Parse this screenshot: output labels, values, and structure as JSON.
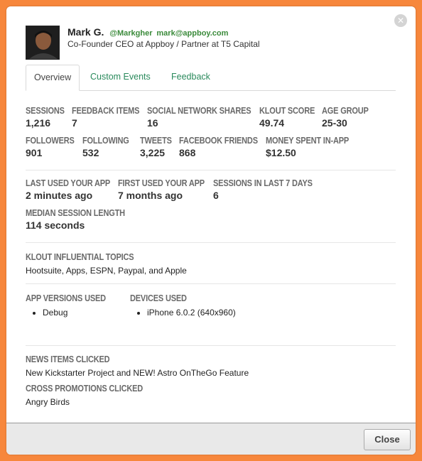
{
  "user": {
    "name": "Mark G.",
    "handle": "@Markgher",
    "email": "mark@appboy.com",
    "title": "Co-Founder CEO at Appboy / Partner at T5 Capital"
  },
  "tabs": [
    "Overview",
    "Custom Events",
    "Feedback"
  ],
  "stats_row1": [
    {
      "label": "SESSIONS",
      "value": "1,216"
    },
    {
      "label": "FEEDBACK ITEMS",
      "value": "7"
    },
    {
      "label": "SOCIAL NETWORK SHARES",
      "value": "16"
    },
    {
      "label": "KLOUT SCORE",
      "value": "49.74"
    },
    {
      "label": "AGE GROUP",
      "value": "25-30"
    }
  ],
  "stats_row2": [
    {
      "label": "FOLLOWERS",
      "value": "901"
    },
    {
      "label": "FOLLOWING",
      "value": "532"
    },
    {
      "label": "TWEETS",
      "value": "3,225"
    },
    {
      "label": "FACEBOOK FRIENDS",
      "value": "868"
    },
    {
      "label": "MONEY SPENT IN-APP",
      "value": "$12.50"
    }
  ],
  "usage": [
    {
      "label": "LAST USED YOUR APP",
      "value": "2 minutes ago"
    },
    {
      "label": "FIRST USED YOUR APP",
      "value": "7 months ago"
    },
    {
      "label": "SESSIONS IN LAST 7 DAYS",
      "value": "6"
    },
    {
      "label": "MEDIAN SESSION LENGTH",
      "value": "114 seconds"
    }
  ],
  "klout": {
    "label": "KLOUT INFLUENTIAL TOPICS",
    "value": "Hootsuite, Apps, ESPN, Paypal, and Apple"
  },
  "app_versions": {
    "label": "APP VERSIONS USED",
    "items": [
      "Debug"
    ]
  },
  "devices": {
    "label": "DEVICES USED",
    "items": [
      "iPhone 6.0.2 (640x960)"
    ]
  },
  "news": {
    "label": "NEWS ITEMS CLICKED",
    "value": "New Kickstarter Project and NEW! Astro OnTheGo Feature"
  },
  "cross_promotions": {
    "label": "CROSS PROMOTIONS CLICKED",
    "value": "Angry Birds"
  },
  "footer": {
    "close_label": "Close"
  },
  "icons": {
    "dismiss": "close-icon",
    "avatar": "user-avatar"
  },
  "colors": {
    "background": "#f7873c",
    "link": "#2a8a5c",
    "handle": "#3a8a3a"
  }
}
